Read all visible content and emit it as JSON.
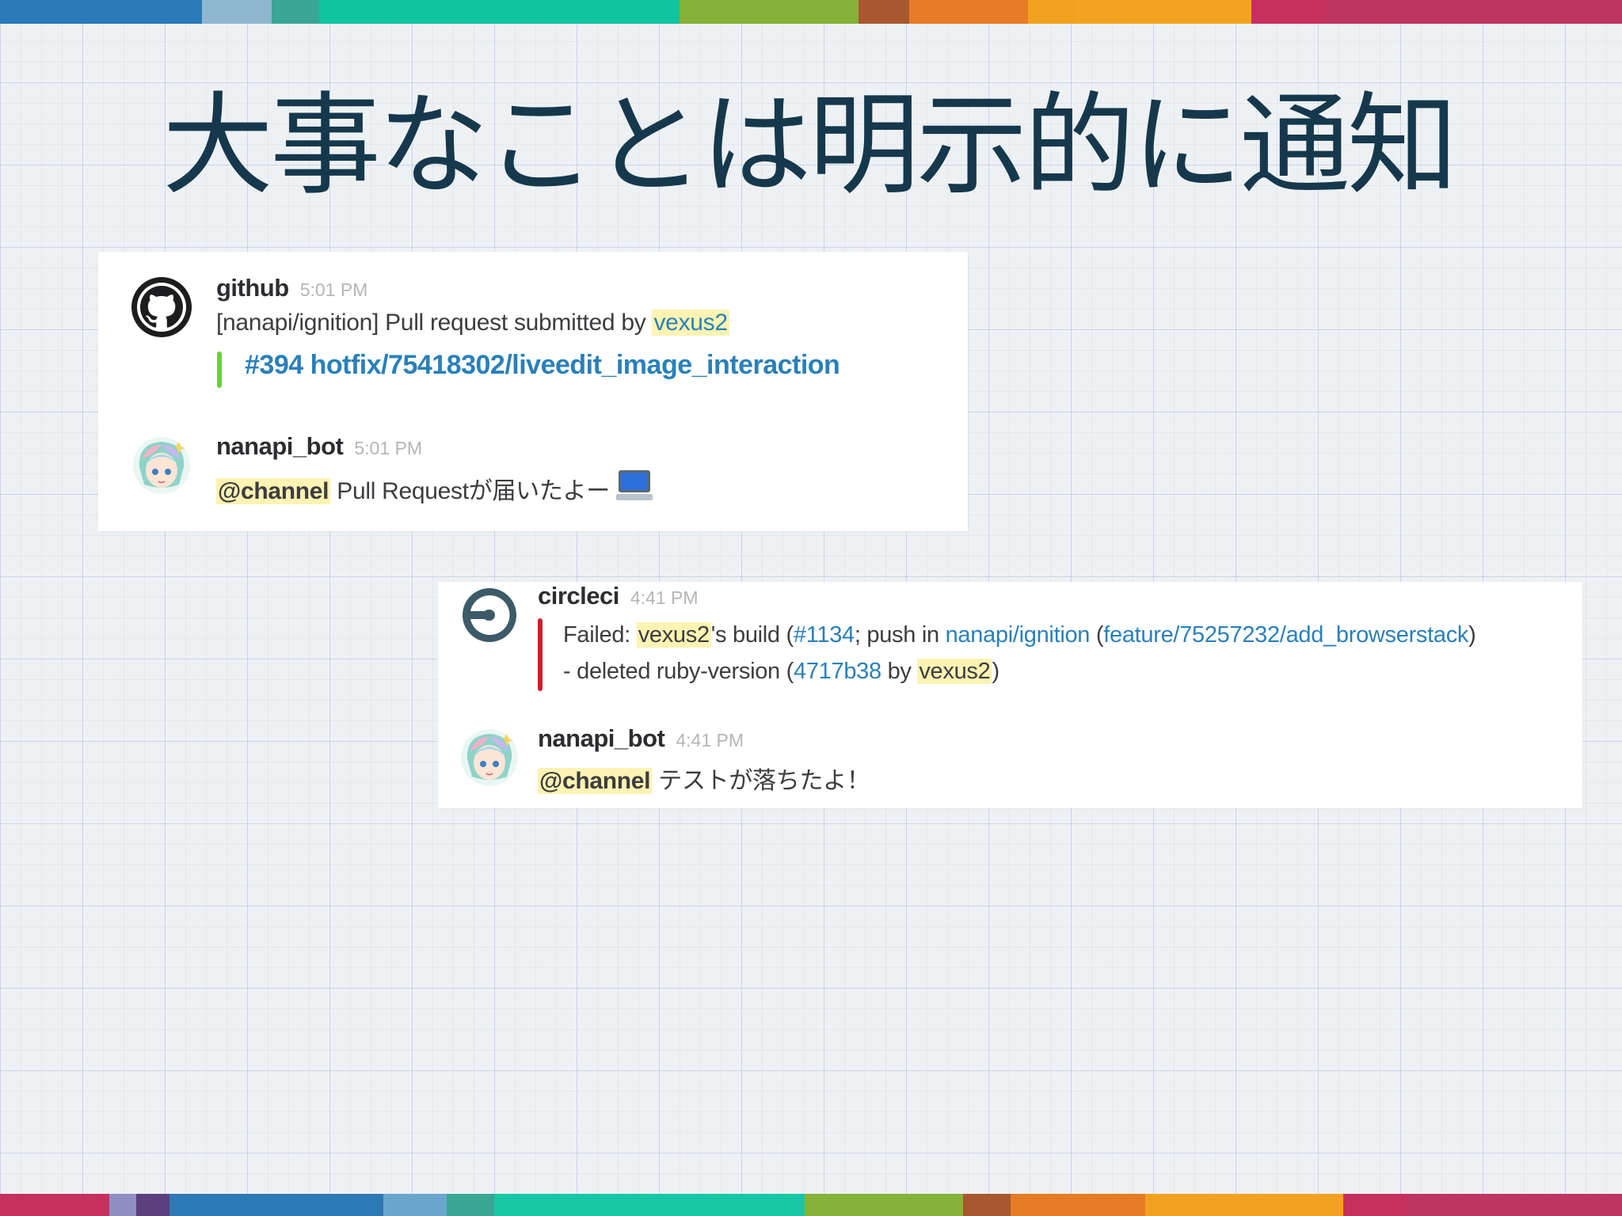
{
  "slide": {
    "title": "大事なことは明示的に通知",
    "stripe_colors_top": [
      "#2b79b6",
      "#8fb7cf",
      "#3aa694",
      "#11c4a0",
      "#17c7a3",
      "#86b23a",
      "#a8582e",
      "#e67c26",
      "#f2a11f",
      "#f4a321",
      "#c6305d",
      "#bd3560"
    ],
    "stripe_colors_bottom": [
      "#c6305d",
      "#8e8ec4",
      "#5b3f7f",
      "#2d79b6",
      "#6aa6cc",
      "#3aa694",
      "#17c7a3",
      "#86b23a",
      "#a8582e",
      "#e67c26",
      "#f2a11f",
      "#c6305d",
      "#bd3560"
    ]
  },
  "card1": {
    "github": {
      "avatar_icon": "github-octocat-icon",
      "sender": "github",
      "time": "5:01 PM",
      "text_prefix": "[nanapi/ignition] Pull request submitted by ",
      "user": "vexus2",
      "attachment_color": "#6bd03f",
      "attachment_title": "#394 hotfix/75418302/liveedit_image_interaction"
    },
    "bot": {
      "avatar_icon": "nanapi-bot-avatar-icon",
      "sender": "nanapi_bot",
      "time": "5:01 PM",
      "mention": "@channel",
      "text": " Pull Requestが届いたよー",
      "emoji_icon": "computer-emoji-icon"
    }
  },
  "card2": {
    "circleci": {
      "avatar_icon": "circleci-logo-icon",
      "sender": "circleci",
      "time": "4:41 PM",
      "attachment_color": "#d11c2e",
      "line1": {
        "failed": "Failed:  ",
        "user": "vexus2",
        "build_text": "'s build (",
        "build_num": "#1134",
        "push_text": "; push in ",
        "repo": "nanapi/ignition",
        "paren_open": " (",
        "branch": "feature/75257232/add_browserstack",
        "paren_close": ")"
      },
      "line2": {
        "prefix": "- deleted ruby-version (",
        "commit": "4717b38",
        "by": " by ",
        "user": "vexus2",
        "close": ")"
      }
    },
    "bot": {
      "avatar_icon": "nanapi-bot-avatar-icon",
      "sender": "nanapi_bot",
      "time": "4:41 PM",
      "mention": "@channel",
      "text": " テストが落ちたよ！"
    }
  }
}
